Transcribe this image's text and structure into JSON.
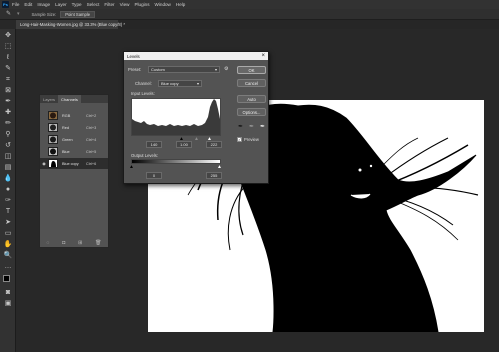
{
  "menubar": {
    "logo": "Ps",
    "items": [
      "File",
      "Edit",
      "Image",
      "Layer",
      "Type",
      "Select",
      "Filter",
      "View",
      "Plugins",
      "Window",
      "Help"
    ]
  },
  "options": {
    "sample_size_label": "Sample Size:",
    "sample_size_value": "Point Sample"
  },
  "document": {
    "tab_title": "Long-Hair-Masking-Women.jpg @ 33.3% (Blue copy/8) *"
  },
  "channels_panel": {
    "tabs": [
      "Layers",
      "Channels"
    ],
    "channels": [
      {
        "name": "RGB",
        "shortcut": "Ctrl+2",
        "thumb": "color"
      },
      {
        "name": "Red",
        "shortcut": "Ctrl+3",
        "thumb": "red"
      },
      {
        "name": "Green",
        "shortcut": "Ctrl+4",
        "thumb": "green"
      },
      {
        "name": "Blue",
        "shortcut": "Ctrl+5",
        "thumb": "blue"
      },
      {
        "name": "Blue copy",
        "shortcut": "Ctrl+6",
        "thumb": "mask"
      }
    ]
  },
  "levels": {
    "title": "Levels",
    "preset_label": "Preset:",
    "preset_value": "Custom",
    "channel_label": "Channel:",
    "channel_value": "Blue copy",
    "input_label": "Input Levels:",
    "input_values": [
      "140",
      "1.00",
      "222"
    ],
    "output_label": "Output Levels:",
    "output_values": [
      "0",
      "255"
    ],
    "buttons": {
      "ok": "OK",
      "cancel": "Cancel",
      "auto": "Auto",
      "options": "Options..."
    },
    "preview_label": "Preview",
    "preview_checked": true
  },
  "colors": {
    "accent": "#31a8ff",
    "panel": "#535353",
    "canvas": "#ffffff"
  }
}
